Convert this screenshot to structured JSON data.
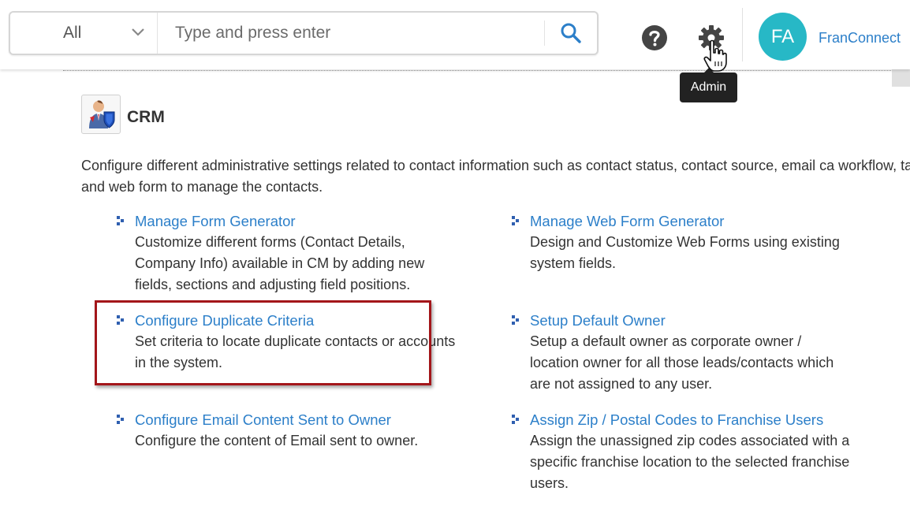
{
  "header": {
    "search": {
      "scope_value": "All",
      "placeholder": "Type and press enter",
      "input_value": ""
    },
    "icons": {
      "help": "help-circle-icon",
      "settings": "gear-icon",
      "search": "search-icon",
      "scope_dropdown": "chevron-down-icon",
      "cursor": "hand-pointer-cursor"
    },
    "user": {
      "initials": "FA",
      "name": "FranConnect"
    },
    "tooltip": "Admin"
  },
  "module": {
    "title": "CRM",
    "description": "Configure different administrative settings related to contact information such as contact status, contact source, email ca workflow, tasks and web form to manage the contacts."
  },
  "links": [
    {
      "title": "Manage Form Generator",
      "description": "Customize different forms (Contact Details, Company Info) available in CM by adding new fields, sections and adjusting field positions."
    },
    {
      "title": "Manage Web Form Generator",
      "description": "Design and Customize Web Forms using existing system fields."
    },
    {
      "title": "Configure Duplicate Criteria",
      "description": "Set criteria to locate duplicate contacts or accounts in the system.",
      "highlighted": true
    },
    {
      "title": "Setup Default Owner",
      "description": "Setup a default owner as corporate owner / location owner for all those leads/contacts which are not assigned to any user."
    },
    {
      "title": "Configure Email Content Sent to Owner",
      "description": "Configure the content of Email sent to owner."
    },
    {
      "title": "Assign Zip / Postal Codes to Franchise Users",
      "description": "Assign the unassigned zip codes associated with a specific franchise location to the selected franchise users."
    }
  ],
  "colors": {
    "link": "#2c7fc9",
    "avatar": "#27b8c6",
    "highlight_border": "#a3161a",
    "bullet": "#2f5fb0",
    "icon_gray": "#444444"
  }
}
